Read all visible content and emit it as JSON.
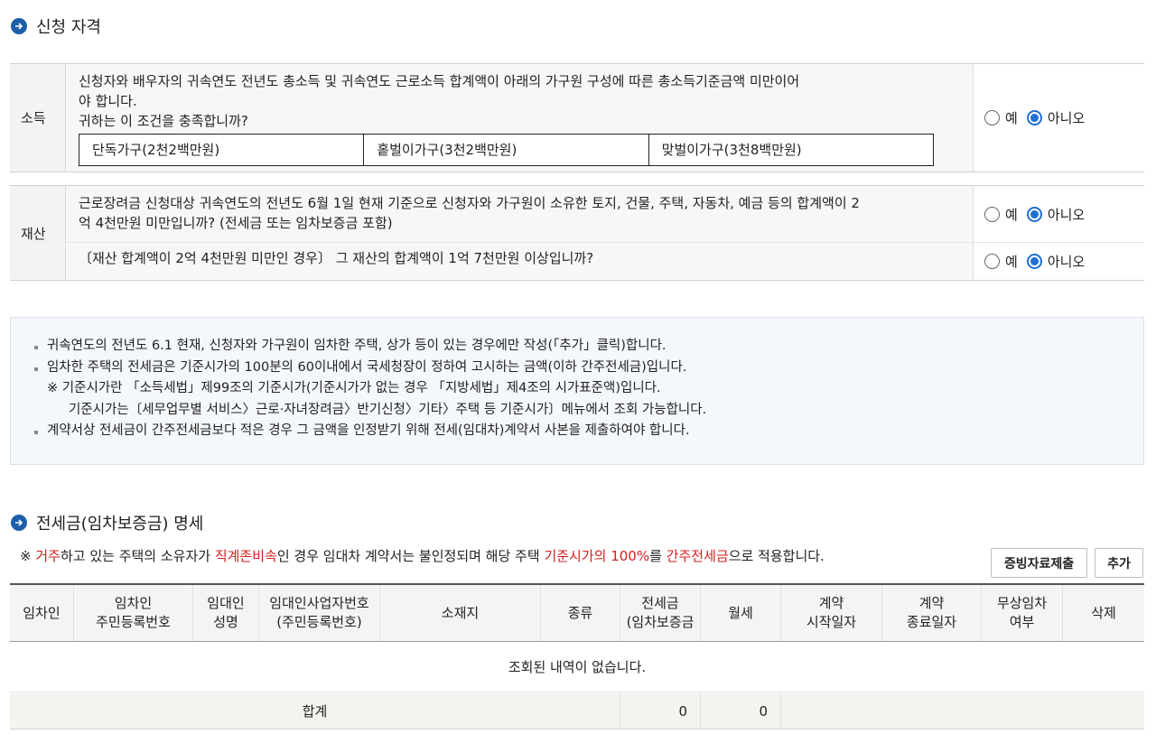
{
  "section1": {
    "title": "신청 자격"
  },
  "income": {
    "category": "소득",
    "question_line1": "신청자와 배우자의 귀속연도 전년도 총소득 및 귀속연도 근로소득 합계액이 아래의 가구원 구성에 따른 총소득기준금액 미만이어",
    "question_line2": "야 합니다.",
    "question_line3": "귀하는 이 조건을 충족합니까?",
    "households": [
      "단독가구(2천2백만원)",
      "홑벌이가구(3천2백만원)",
      "맞벌이가구(3천8백만원)"
    ],
    "answer": {
      "yes": "예",
      "no": "아니오",
      "selected": "no"
    }
  },
  "assets": {
    "category": "재산",
    "question1_line1": "근로장려금 신청대상 귀속연도의 전년도 6월 1일 현재 기준으로 신청자와 가구원이 소유한 토지, 건물, 주택, 자동차, 예금 등의 합계액이 2",
    "question1_line2": "억 4천만원 미만입니까? (전세금 또는 임차보증금 포함)",
    "answer1": {
      "yes": "예",
      "no": "아니오",
      "selected": "no"
    },
    "question2": "〔재산 합계액이 2억 4천만원 미만인 경우〕 그 재산의 합계액이 1억 7천만원 이상입니까?",
    "answer2": {
      "yes": "예",
      "no": "아니오",
      "selected": "no"
    }
  },
  "notice": {
    "item1": "귀속연도의 전년도 6.1 현재, 신청자와 가구원이 임차한 주택, 상가 등이 있는 경우에만 작성(「추가」클릭)합니다.",
    "item2": "임차한 주택의 전세금은 기준시가의 100분의 60이내에서 국세청장이 정하여 고시하는 금액(이하 간주전세금)입니다.",
    "sub1": "※ 기준시가란 「소득세법」제99조의 기준시가(기준시가가 없는 경우 「지방세법」제4조의 시가표준액)입니다.",
    "sub2": "기준시가는〔세무업무별 서비스〉근로·자녀장려금〉반기신청〉기타〉주택 등 기준시가〕메뉴에서 조회 가능합니다.",
    "item3": "계약서상 전세금이 간주전세금보다 적은 경우 그 금액을 인정받기 위해 전세(임대차)계약서 사본을 제출하여야 합니다."
  },
  "section2": {
    "title": "전세금(임차보증금) 명세"
  },
  "warning": {
    "prefix": "※ ",
    "p1": "거주",
    "t1": "하고 있는 주택의 소유자가 ",
    "p2": "직계존비속",
    "t2": "인 경우 임대차 계약서는 불인정되며 해당 주택 ",
    "p3": "기준시가의 100%",
    "t3": "를 ",
    "p4": "간주전세금",
    "t4": "으로 적용합니다."
  },
  "buttons": {
    "evidence": "증빙자료제출",
    "add": "추가"
  },
  "table": {
    "headers": [
      [
        "임차인"
      ],
      [
        "임차인",
        "주민등록번호"
      ],
      [
        "임대인",
        "성명"
      ],
      [
        "임대인사업자번호",
        "(주민등록번호)"
      ],
      [
        "소재지"
      ],
      [
        "종류"
      ],
      [
        "전세금",
        "(임차보증금"
      ],
      [
        "월세"
      ],
      [
        "계약",
        "시작일자"
      ],
      [
        "계약",
        "종료일자"
      ],
      [
        "무상임차",
        "여부"
      ],
      [
        "삭제"
      ]
    ],
    "empty_message": "조회된 내역이 없습니다.",
    "total_label": "합계",
    "total_deposit": "0",
    "total_monthly": "0"
  }
}
